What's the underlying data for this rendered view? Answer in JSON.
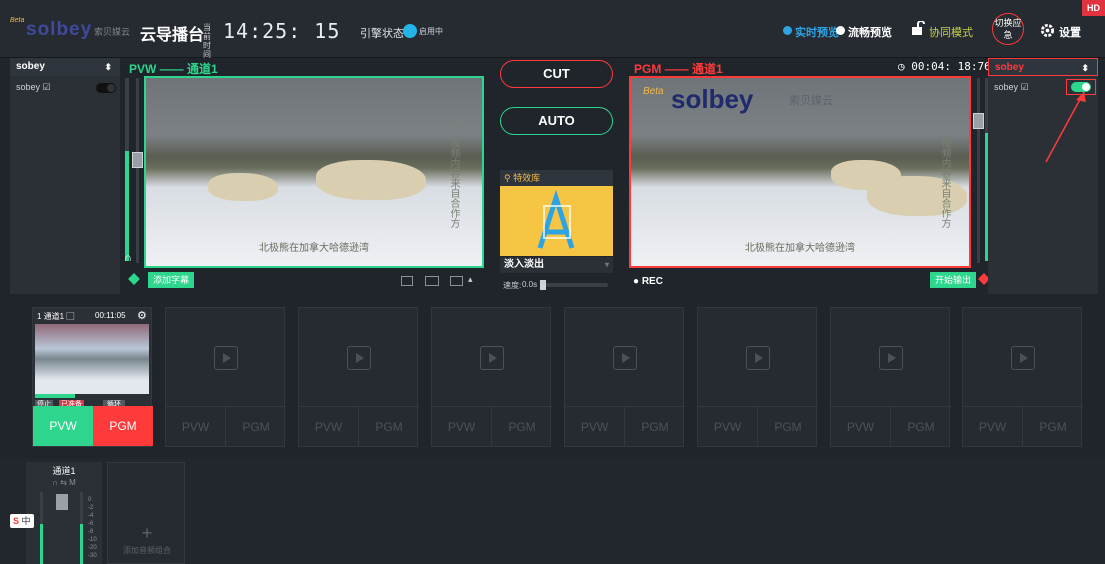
{
  "topbar": {
    "logo": "solbey",
    "logo_sub": "索贝媒云",
    "title": "云导播台",
    "time_label": "当前时间",
    "clock": "14:25: 15",
    "stream_label": "引擎状态",
    "stream_state": "启用中",
    "realtime_preview": "实时预览",
    "smooth_preview": "流畅预览",
    "collab_mode": "协同模式",
    "emergency": "切换应急",
    "settings": "设置",
    "hd": "HD"
  },
  "left_panel": {
    "source": "sobey",
    "item": "sobey ☑"
  },
  "right_panel": {
    "source": "sobey",
    "item": "sobey ☑"
  },
  "pvw": {
    "label": "PVW —— 通道1",
    "subtitle": "北极熊在加拿大哈德逊湾",
    "vtext": "以上视频内容来自合作方",
    "add_caption": "添加字幕"
  },
  "pgm": {
    "label": "PGM —— 通道1",
    "timer": "00:04: 18:76",
    "subtitle": "北极熊在加拿大哈德逊湾",
    "vtext": "以上视频内容来自合作方",
    "rec": "● REC",
    "start_output": "开始输出",
    "watermark": "solbey",
    "watermark_sub": "索贝媒云",
    "beta": "Beta"
  },
  "center": {
    "cut": "CUT",
    "auto": "AUTO",
    "fx_lib": "特效库",
    "transition": "淡入淡出",
    "speed_label": "速度:",
    "speed": "0.0s"
  },
  "channel1": {
    "name": "1 通道1 ▢",
    "duration": "00:11:05",
    "stop": "停止",
    "ready": "已准备",
    "loop": "循环",
    "pvw": "PVW",
    "pgm": "PGM"
  },
  "slot_labels": {
    "pvw": "PVW",
    "pgm": "PGM"
  },
  "audio": {
    "channel": "通道1",
    "icons": "∩ ⇆ M",
    "add": "添加音频组合",
    "scale": [
      "0",
      "-2",
      "-4",
      "-6",
      "-8",
      "-10",
      "-20",
      "-30"
    ]
  },
  "ime": {
    "label": "中"
  },
  "colors": {
    "pvw_green": "#2ed58c",
    "pgm_red": "#ff3a3a",
    "accent_blue": "#2ea3e3"
  }
}
